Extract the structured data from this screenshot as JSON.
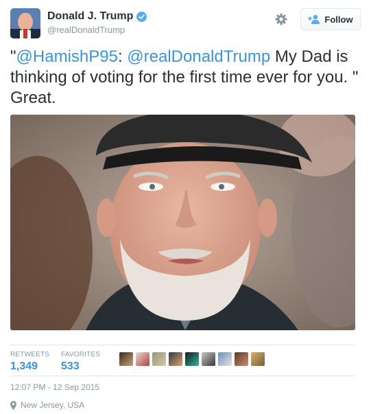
{
  "user": {
    "display_name": "Donald J. Trump",
    "screen_name": "@realDonaldTrump",
    "verified_icon": "verified-badge-icon",
    "avatar_icon": "user-avatar"
  },
  "actions": {
    "settings_icon": "gear-icon",
    "follow_icon": "add-person-icon",
    "follow_label": "Follow"
  },
  "tweet": {
    "open_quote": "\"",
    "mention_1": "@HamishP95",
    "colon": ": ",
    "mention_2": "@realDonaldTrump",
    "body": " My Dad is thinking of voting for the first time ever for you. \" Great."
  },
  "stats": {
    "retweets_label": "RETWEETS",
    "retweets_value": "1,349",
    "favorites_label": "FAVORITES",
    "favorites_value": "533"
  },
  "faces": [
    "avatar-1",
    "avatar-2",
    "avatar-3",
    "avatar-4",
    "avatar-5",
    "avatar-6",
    "avatar-7",
    "avatar-8",
    "avatar-9"
  ],
  "timestamp": "12:07 PM - 12 Sep 2015",
  "location": {
    "icon": "map-pin-icon",
    "text": "New Jersey, USA"
  },
  "colors": {
    "link": "#3b94d9",
    "text": "#292f33",
    "muted": "#8899a6",
    "verified": "#55acee"
  }
}
